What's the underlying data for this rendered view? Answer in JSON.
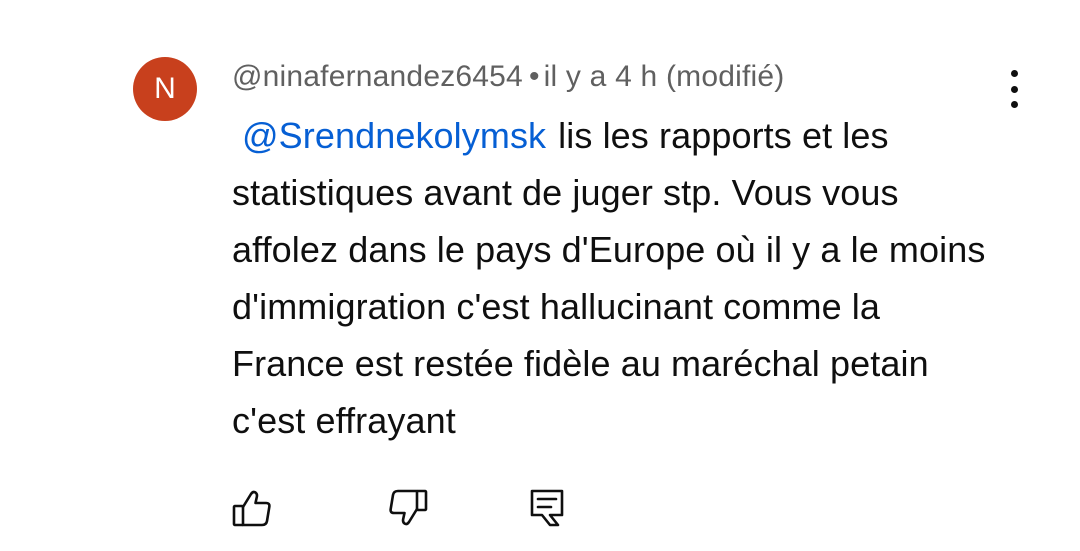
{
  "comment": {
    "avatar_letter": "N",
    "avatar_color": "#c8401d",
    "author": "@ninafernandez6454",
    "separator": "•",
    "timestamp": "il y a 4 h",
    "edited_label": "(modifié)",
    "mention": "@Srendnekolymsk",
    "mention_color": "#065fd4",
    "text": "lis les rapports et les statistiques avant de juger stp. Vous vous affolez dans le pays d'Europe où il y a le moins d'immigration c'est hallucinant comme la France est restée fidèle au maréchal petain c'est effrayant"
  },
  "menu": {
    "icon": "more-vert-icon"
  },
  "actions": {
    "like_icon": "thumb-up-icon",
    "dislike_icon": "thumb-down-icon",
    "reply_icon": "comment-reply-icon"
  }
}
